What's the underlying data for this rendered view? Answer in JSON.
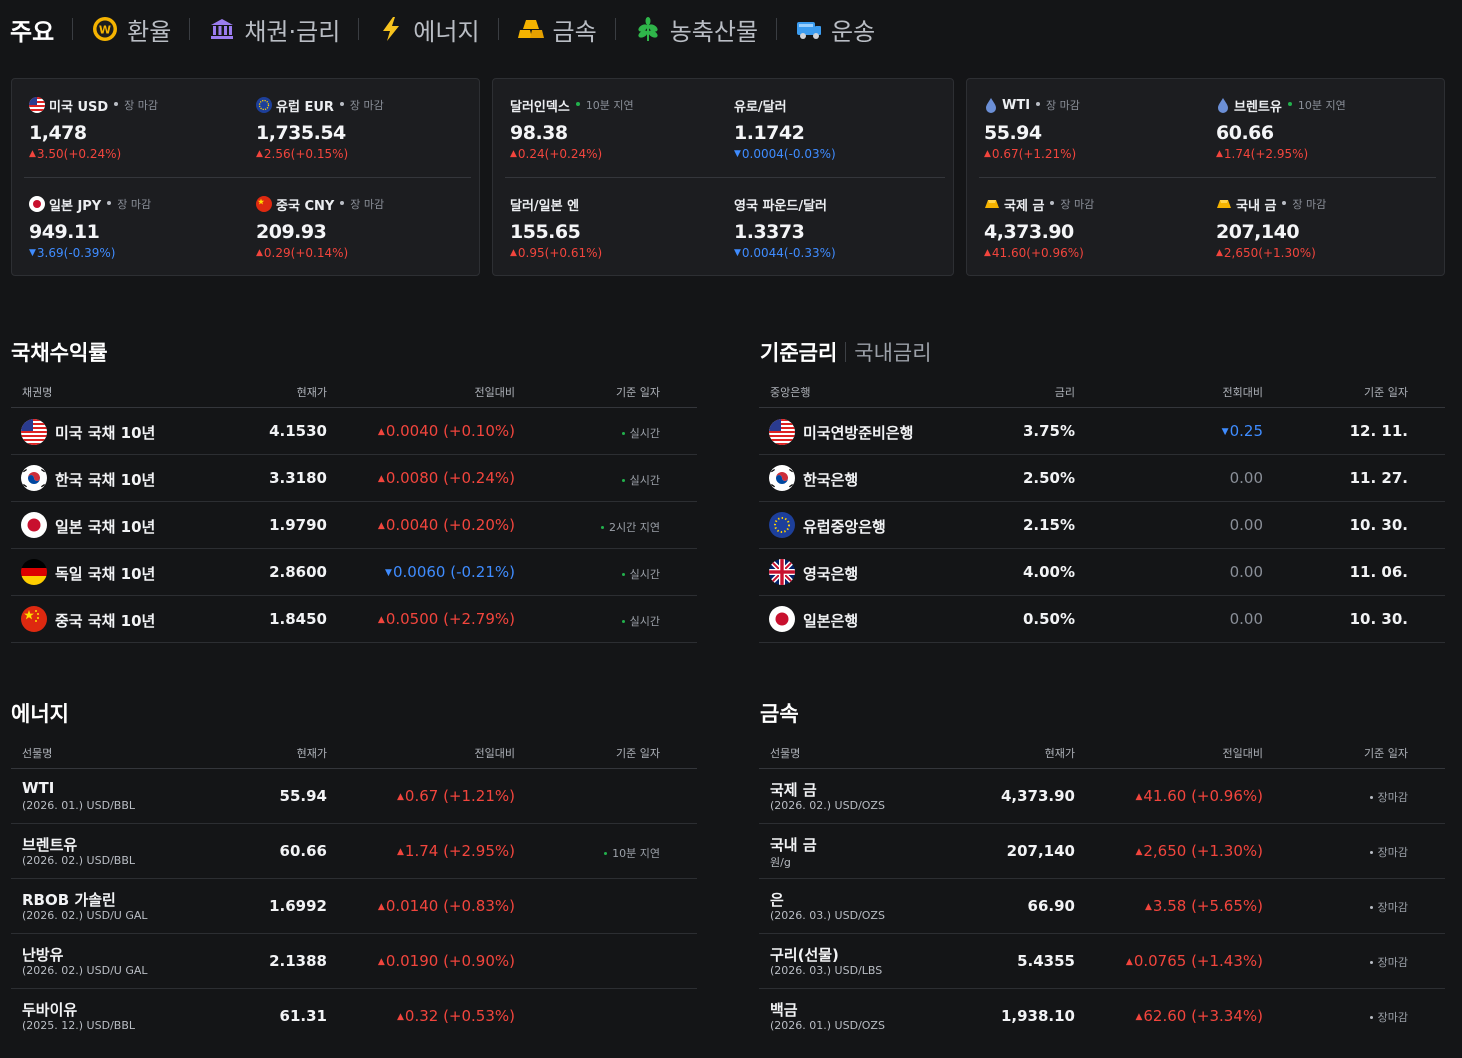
{
  "nav": {
    "tabs": [
      {
        "label": "주요",
        "icon": "none"
      },
      {
        "label": "환율",
        "icon": "won-coin-icon"
      },
      {
        "label": "채권·금리",
        "icon": "bank-icon"
      },
      {
        "label": "에너지",
        "icon": "lightning-icon"
      },
      {
        "label": "금속",
        "icon": "gold-bars-icon"
      },
      {
        "label": "농축산물",
        "icon": "plant-icon"
      },
      {
        "label": "운송",
        "icon": "truck-icon"
      }
    ]
  },
  "summary": {
    "fx": [
      {
        "name": "미국 USD",
        "tag": "장 마감",
        "value": "1,478",
        "change": "3.50(+0.24%)",
        "dir": "up",
        "flag": "us"
      },
      {
        "name": "유럽 EUR",
        "tag": "장 마감",
        "value": "1,735.54",
        "change": "2.56(+0.15%)",
        "dir": "up",
        "flag": "eu"
      },
      {
        "name": "일본 JPY",
        "tag": "장 마감",
        "value": "949.11",
        "change": "3.69(-0.39%)",
        "dir": "down",
        "flag": "jp"
      },
      {
        "name": "중국 CNY",
        "tag": "장 마감",
        "value": "209.93",
        "change": "0.29(+0.14%)",
        "dir": "up",
        "flag": "cn"
      }
    ],
    "index": [
      {
        "name": "달러인덱스",
        "tag": "10분 지연",
        "value": "98.38",
        "change": "0.24(+0.24%)",
        "dir": "up"
      },
      {
        "name": "유로/달러",
        "tag": "",
        "value": "1.1742",
        "change": "0.0004(-0.03%)",
        "dir": "down"
      },
      {
        "name": "달러/일본 엔",
        "tag": "",
        "value": "155.65",
        "change": "0.95(+0.61%)",
        "dir": "up"
      },
      {
        "name": "영국 파운드/달러",
        "tag": "",
        "value": "1.3373",
        "change": "0.0044(-0.33%)",
        "dir": "down"
      }
    ],
    "commodity": [
      {
        "name": "WTI",
        "tag": "장 마감",
        "value": "55.94",
        "change": "0.67(+1.21%)",
        "dir": "up",
        "icon": "oil-drop-icon"
      },
      {
        "name": "브렌트유",
        "tag": "10분 지연",
        "value": "60.66",
        "change": "1.74(+2.95%)",
        "dir": "up",
        "icon": "oil-drop-icon"
      },
      {
        "name": "국제 금",
        "tag": "장 마감",
        "value": "4,373.90",
        "change": "41.60(+0.96%)",
        "dir": "up",
        "icon": "gold-icon"
      },
      {
        "name": "국내 금",
        "tag": "장 마감",
        "value": "207,140",
        "change": "2,650(+1.30%)",
        "dir": "up",
        "icon": "gold-icon"
      }
    ]
  },
  "bonds": {
    "title": "국채수익률",
    "headers": [
      "채권명",
      "현재가",
      "전일대비",
      "기준 일자"
    ],
    "rows": [
      {
        "name": "미국 국채 10년",
        "flag": "us",
        "price": "4.1530",
        "change": "0.0040 (+0.10%)",
        "dir": "up",
        "date": "실시간"
      },
      {
        "name": "한국 국채 10년",
        "flag": "kr",
        "price": "3.3180",
        "change": "0.0080 (+0.24%)",
        "dir": "up",
        "date": "실시간"
      },
      {
        "name": "일본 국채 10년",
        "flag": "jp",
        "price": "1.9790",
        "change": "0.0040 (+0.20%)",
        "dir": "up",
        "date": "2시간 지연"
      },
      {
        "name": "독일 국채 10년",
        "flag": "de",
        "price": "2.8600",
        "change": "0.0060 (-0.21%)",
        "dir": "down",
        "date": "실시간"
      },
      {
        "name": "중국 국채 10년",
        "flag": "cn",
        "price": "1.8450",
        "change": "0.0500 (+2.79%)",
        "dir": "up",
        "date": "실시간"
      }
    ]
  },
  "rates": {
    "title": "기준금리",
    "alt_tab": "국내금리",
    "headers": [
      "중앙은행",
      "금리",
      "전회대비",
      "기준 일자"
    ],
    "rows": [
      {
        "name": "미국연방준비은행",
        "flag": "us",
        "rate": "3.75%",
        "change": "0.25",
        "dir": "down",
        "date": "12. 11."
      },
      {
        "name": "한국은행",
        "flag": "kr",
        "rate": "2.50%",
        "change": "0.00",
        "dir": "flat",
        "date": "11. 27."
      },
      {
        "name": "유럽중앙은행",
        "flag": "eu",
        "rate": "2.15%",
        "change": "0.00",
        "dir": "flat",
        "date": "10. 30."
      },
      {
        "name": "영국은행",
        "flag": "gb",
        "rate": "4.00%",
        "change": "0.00",
        "dir": "flat",
        "date": "11. 06."
      },
      {
        "name": "일본은행",
        "flag": "jp",
        "rate": "0.50%",
        "change": "0.00",
        "dir": "flat",
        "date": "10. 30."
      }
    ]
  },
  "energy": {
    "title": "에너지",
    "headers": [
      "선물명",
      "현재가",
      "전일대비",
      "기준 일자"
    ],
    "rows": [
      {
        "name": "WTI",
        "sub": "(2026. 01.) USD/BBL",
        "price": "55.94",
        "change": "0.67 (+1.21%)",
        "dir": "up",
        "date": ""
      },
      {
        "name": "브렌트유",
        "sub": "(2026. 02.) USD/BBL",
        "price": "60.66",
        "change": "1.74 (+2.95%)",
        "dir": "up",
        "date": "10분 지연"
      },
      {
        "name": "RBOB 가솔린",
        "sub": "(2026. 02.) USD/U GAL",
        "price": "1.6992",
        "change": "0.0140 (+0.83%)",
        "dir": "up",
        "date": ""
      },
      {
        "name": "난방유",
        "sub": "(2026. 02.) USD/U GAL",
        "price": "2.1388",
        "change": "0.0190 (+0.90%)",
        "dir": "up",
        "date": ""
      },
      {
        "name": "두바이유",
        "sub": "(2025. 12.) USD/BBL",
        "price": "61.31",
        "change": "0.32 (+0.53%)",
        "dir": "up",
        "date": ""
      }
    ]
  },
  "metals": {
    "title": "금속",
    "headers": [
      "선물명",
      "현재가",
      "전일대비",
      "기준 일자"
    ],
    "rows": [
      {
        "name": "국제 금",
        "sub": "(2026. 02.) USD/OZS",
        "price": "4,373.90",
        "change": "41.60 (+0.96%)",
        "dir": "up",
        "date": "장마감"
      },
      {
        "name": "국내 금",
        "sub": "원/g",
        "price": "207,140",
        "change": "2,650 (+1.30%)",
        "dir": "up",
        "date": "장마감"
      },
      {
        "name": "은",
        "sub": "(2026. 03.) USD/OZS",
        "price": "66.90",
        "change": "3.58 (+5.65%)",
        "dir": "up",
        "date": "장마감"
      },
      {
        "name": "구리(선물)",
        "sub": "(2026. 03.) USD/LBS",
        "price": "5.4355",
        "change": "0.0765 (+1.43%)",
        "dir": "up",
        "date": "장마감"
      },
      {
        "name": "백금",
        "sub": "(2026. 01.) USD/OZS",
        "price": "1,938.10",
        "change": "62.60 (+3.34%)",
        "dir": "up",
        "date": "장마감"
      }
    ]
  },
  "colors": {
    "up": "#f2453d",
    "down": "#3f8cff",
    "flat": "#8a8f98",
    "background": "#141517",
    "card": "#1c1d20"
  }
}
